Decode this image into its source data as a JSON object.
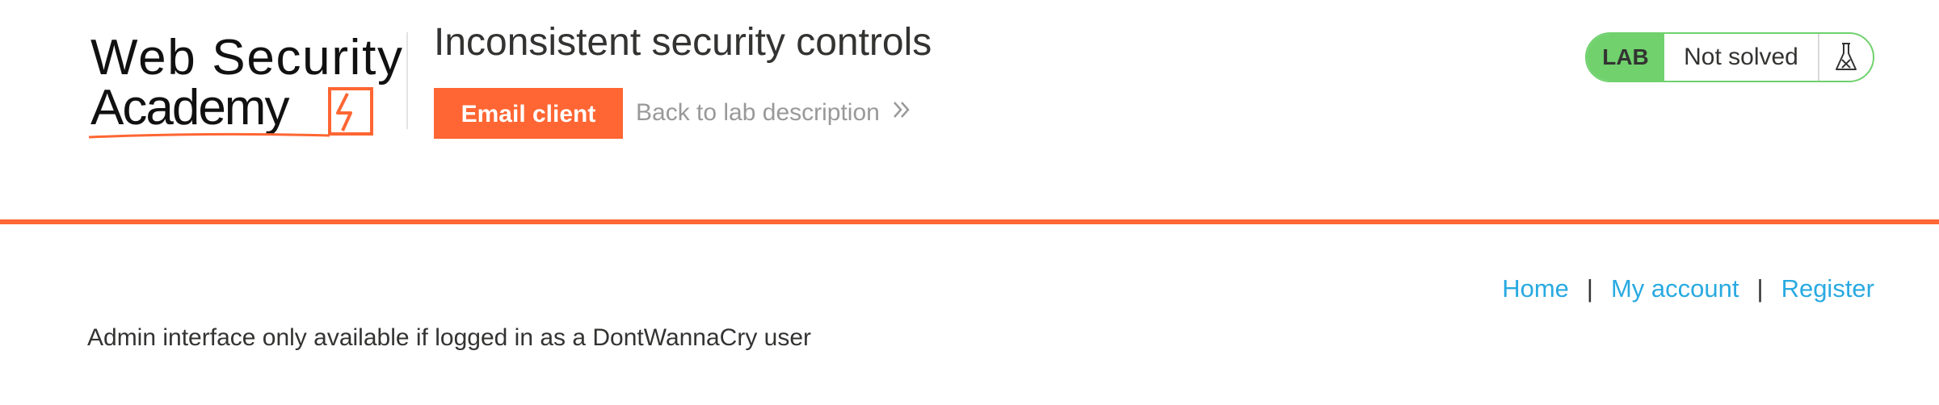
{
  "brand": {
    "logo_line1": "Web Security",
    "logo_line2": "Academy"
  },
  "header": {
    "lab_title": "Inconsistent security controls",
    "email_client_label": "Email client",
    "back_link_label": "Back to lab description",
    "status": {
      "badge": "LAB",
      "state": "Not solved"
    }
  },
  "nav": {
    "home": "Home",
    "my_account": "My account",
    "register": "Register",
    "separator": "|"
  },
  "main": {
    "notice": "Admin interface only available if logged in as a DontWannaCry user"
  },
  "colors": {
    "accent_orange": "#ff6633",
    "lab_green": "#70d16d",
    "link_blue": "#29aae1",
    "text_dark": "#333332",
    "text_muted": "#999999"
  },
  "icons": {
    "flask": "flask-icon",
    "chevron": "double-chevron-right-icon",
    "logo_mark": "lightning-bolt-icon"
  }
}
